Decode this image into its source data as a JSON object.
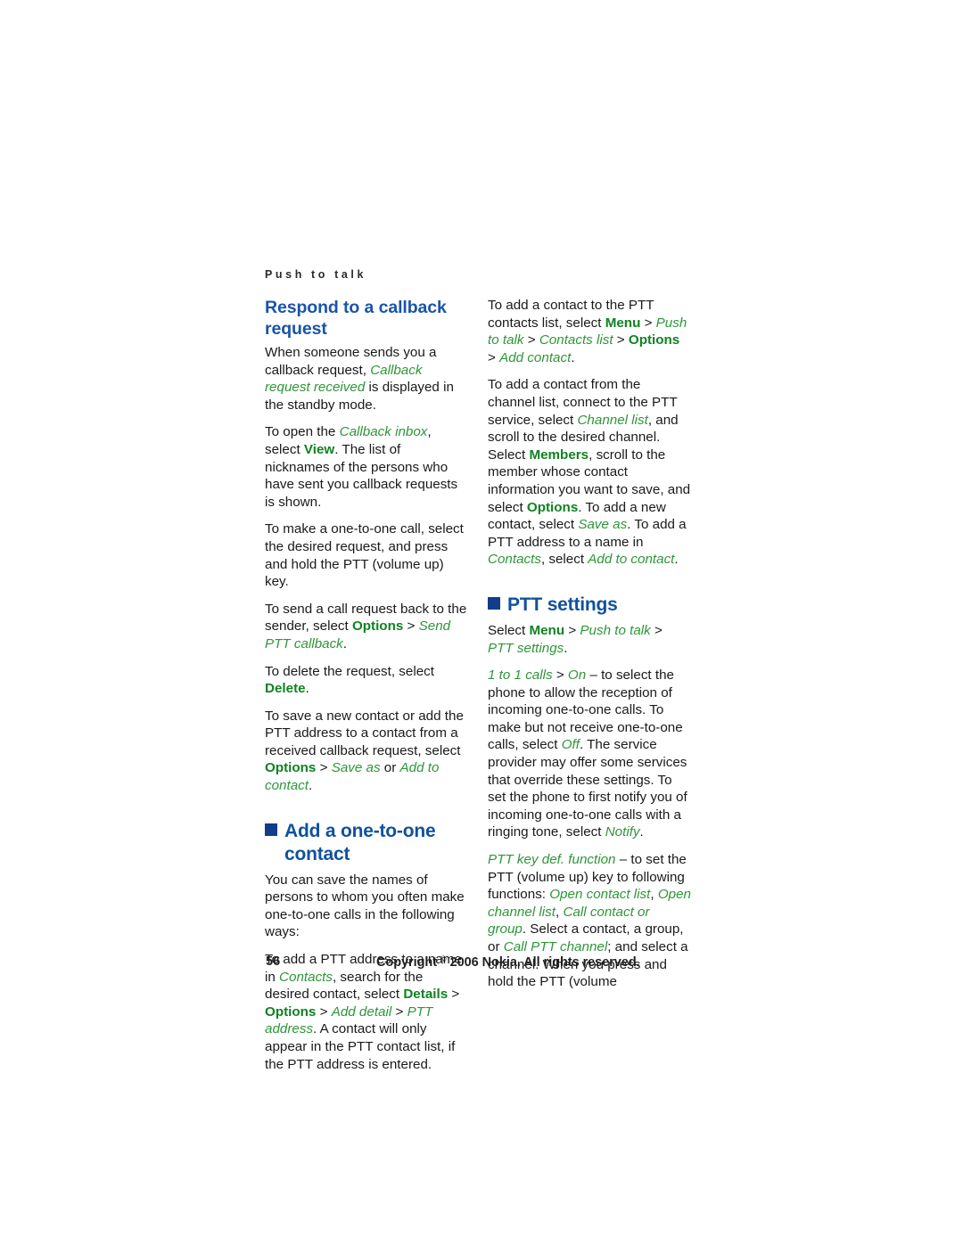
{
  "page": {
    "running_header": "Push to talk",
    "folio": "56",
    "copyright_pre": "Copyright ",
    "copyright_symbol": "©",
    "copyright_post": " 2006 Nokia. All rights reserved.",
    "colors": {
      "heading_blue": "#1a54a8",
      "main_heading_blue": "#10519e",
      "square_bullet_blue": "#123d8a",
      "ui_bold_green": "#0f8222",
      "ui_italic_green": "#2f9638",
      "body_text": "#1a1a1a",
      "background": "#ffffff"
    }
  },
  "left_column": {
    "h1": "Respond to a callback request",
    "p1_a": "When someone sends you a callback request, ",
    "p1_i1": "Callback request received",
    "p1_b": " is displayed in the standby mode.",
    "p2_a": "To open the ",
    "p2_i1": "Callback inbox",
    "p2_b": ", select ",
    "p2_bold1": "View",
    "p2_c": ". The list of nicknames of the persons who have sent you callback requests is shown.",
    "p3": "To make a one-to-one call, select the desired request, and press and hold the PTT (volume up) key.",
    "p4_a": "To send a call request back to the sender, select ",
    "p4_bold1": "Options",
    "p4_gt1": " > ",
    "p4_i1": "Send PTT callback",
    "p4_b": ".",
    "p5_a": "To delete the request, select ",
    "p5_bold1": "Delete",
    "p5_b": ".",
    "p6_a": "To save a new contact or add the PTT address to a contact from a received callback request, select ",
    "p6_bold1": "Options",
    "p6_gt1": " > ",
    "p6_i1": "Save as",
    "p6_b": " or ",
    "p6_i2": "Add to contact",
    "p6_c": ".",
    "h2": "Add a one-to-one contact",
    "p7": "You can save the names of persons to whom you often make one-to-one calls in the following ways:",
    "p8_a": "To add a PTT address to a name in ",
    "p8_i1": "Contacts",
    "p8_b": ", search for the desired contact, select ",
    "p8_bold1": "Details",
    "p8_gt1": " > ",
    "p8_bold2": "Options",
    "p8_gt2": " > ",
    "p8_i2": "Add detail",
    "p8_gt3": " > ",
    "p8_i3": "PTT address",
    "p8_c": ". A contact will only appear in the PTT contact list, if the PTT address is entered."
  },
  "right_column": {
    "p1_a": "To add a contact to the PTT contacts list, select ",
    "p1_bold1": "Menu",
    "p1_gt1": " > ",
    "p1_i1": "Push to talk",
    "p1_gt2": " > ",
    "p1_i2": "Contacts list",
    "p1_gt3": " > ",
    "p1_bold2": "Options",
    "p1_gt4": " > ",
    "p1_i3": "Add contact",
    "p1_b": ".",
    "p2_a": "To add a contact from the channel list, connect to the PTT service, select ",
    "p2_i1": "Channel list",
    "p2_b": ", and scroll to the desired channel. Select ",
    "p2_bold1": "Members",
    "p2_c": ", scroll to the member whose contact information you want to save, and select ",
    "p2_bold2": "Options",
    "p2_d": ". To add a new contact, select ",
    "p2_i2": "Save as",
    "p2_e": ". To add a PTT address to a name in ",
    "p2_i3": "Contacts",
    "p2_f": ", select ",
    "p2_i4": "Add to contact",
    "p2_g": ".",
    "h2": "PTT settings",
    "p3_a": "Select ",
    "p3_bold1": "Menu",
    "p3_gt1": " > ",
    "p3_i1": "Push to talk",
    "p3_gt2": " > ",
    "p3_i2": "PTT settings",
    "p3_b": ".",
    "p4_i1": "1 to 1 calls",
    "p4_gt1": " > ",
    "p4_i2": "On",
    "p4_a": " – to select the phone to allow the reception of incoming one-to-one calls. To make but not receive one-to-one calls, select ",
    "p4_i3": "Off",
    "p4_b": ". The service provider may offer some services that override these settings. To set the phone to first notify you of incoming one-to-one calls with a ringing tone, select ",
    "p4_i4": "Notify",
    "p4_c": ".",
    "p5_i1": "PTT key def. function",
    "p5_a": " – to set the PTT (volume up) key to following functions: ",
    "p5_i2": "Open contact list",
    "p5_b": ", ",
    "p5_i3": "Open channel list",
    "p5_c": ", ",
    "p5_i4": "Call contact or group",
    "p5_d": ". Select a contact, a group, or ",
    "p5_i5": "Call PTT channel",
    "p5_e": "; and select a channel. When you press and hold the PTT (volume"
  }
}
